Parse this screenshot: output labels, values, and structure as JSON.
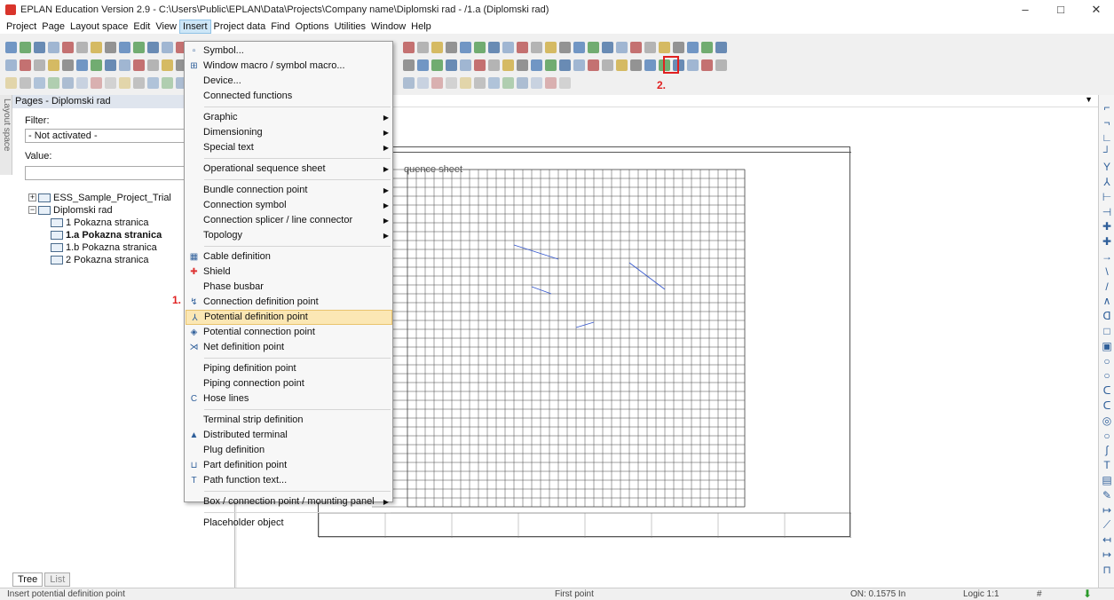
{
  "window": {
    "title": "EPLAN Education Version 2.9 - C:\\Users\\Public\\EPLAN\\Data\\Projects\\Company name\\Diplomski rad - /1.a (Diplomski rad)",
    "minimize": "–",
    "maximize": "□",
    "close": "✕"
  },
  "menubar": [
    "Project",
    "Page",
    "Layout space",
    "Edit",
    "View",
    "Insert",
    "Project data",
    "Find",
    "Options",
    "Utilities",
    "Window",
    "Help"
  ],
  "left_panel": {
    "vertical_tab": "Layout space",
    "header": "Pages - Diplomski rad",
    "filter_label": "Filter:",
    "filter_value": "- Not activated -",
    "value_label": "Value:",
    "value_input": "",
    "tree": [
      {
        "label": "ESS_Sample_Project_Trial",
        "level": 0,
        "expand": "+"
      },
      {
        "label": "Diplomski rad",
        "level": 0,
        "expand": "−"
      },
      {
        "label": "1 Pokazna stranica",
        "level": 1
      },
      {
        "label": "1.a Pokazna stranica",
        "level": 1,
        "selected": true
      },
      {
        "label": "1.b Pokazna stranica",
        "level": 1
      },
      {
        "label": "2 Pokazna stranica",
        "level": 1
      }
    ],
    "tabs": [
      "Tree",
      "List"
    ]
  },
  "insert_menu": [
    {
      "label": "Symbol...",
      "icon": "symbol-icon"
    },
    {
      "label": "Window macro / symbol macro...",
      "icon": "macro-icon"
    },
    {
      "label": "Device..."
    },
    {
      "label": "Connected functions"
    },
    {
      "sep": true
    },
    {
      "label": "Graphic",
      "submenu": true
    },
    {
      "label": "Dimensioning",
      "submenu": true
    },
    {
      "label": "Special text",
      "submenu": true
    },
    {
      "sep": true
    },
    {
      "label": "Operational sequence sheet",
      "submenu": true
    },
    {
      "sep": true
    },
    {
      "label": "Bundle connection point",
      "submenu": true
    },
    {
      "label": "Connection symbol",
      "submenu": true
    },
    {
      "label": "Connection splicer / line connector",
      "submenu": true
    },
    {
      "label": "Topology",
      "submenu": true
    },
    {
      "sep": true
    },
    {
      "label": "Cable definition",
      "icon": "cable-icon"
    },
    {
      "label": "Shield",
      "icon": "shield-icon"
    },
    {
      "label": "Phase busbar"
    },
    {
      "label": "Connection definition point",
      "icon": "connection-def-icon"
    },
    {
      "label": "Potential definition point",
      "icon": "potential-def-icon",
      "highlight": true
    },
    {
      "label": "Potential connection point",
      "icon": "potential-conn-icon"
    },
    {
      "label": "Net definition point",
      "icon": "net-def-icon"
    },
    {
      "sep": true
    },
    {
      "label": "Piping definition point"
    },
    {
      "label": "Piping connection point"
    },
    {
      "label": "Hose lines",
      "icon": "hose-icon"
    },
    {
      "sep": true
    },
    {
      "label": "Terminal strip definition"
    },
    {
      "label": "Distributed terminal",
      "icon": "distributed-terminal-icon"
    },
    {
      "label": "Plug definition"
    },
    {
      "label": "Part definition point",
      "icon": "cart-icon"
    },
    {
      "label": "Path function text...",
      "icon": "path-text-icon"
    },
    {
      "sep": true
    },
    {
      "label": "Box / connection point / mounting panel",
      "submenu": true
    },
    {
      "sep": true
    },
    {
      "label": "Placeholder object"
    }
  ],
  "markers": {
    "menu": "1.",
    "toolbar": "2."
  },
  "drawing": {
    "sequence_title": "quence sheet"
  },
  "status": {
    "left": "Insert potential definition point",
    "center": "First point",
    "on": "ON: 0.1575 In",
    "logic": "Logic 1:1",
    "hash": "#"
  },
  "colors": {
    "accent_red": "#e02020",
    "menu_highlight": "#fbe7b4",
    "toolbar_blue": "#2f5f9a"
  }
}
